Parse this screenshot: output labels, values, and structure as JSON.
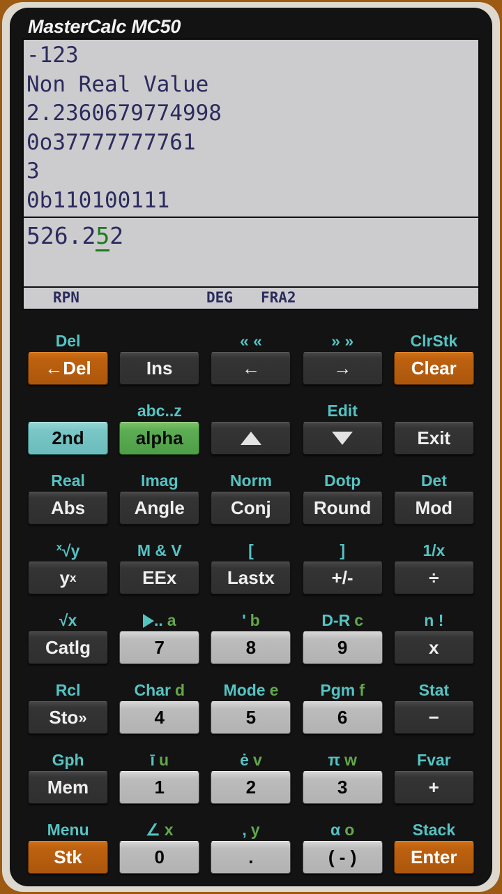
{
  "app": {
    "title": "MasterCalc MC50"
  },
  "display": {
    "stack": [
      "-123",
      "Non Real Value",
      "2.2360679774998",
      "0o37777777761",
      "3",
      "0b110100111"
    ],
    "entry": {
      "before_cursor": "526.2",
      "cursor_char": "5",
      "after_cursor": "2",
      "full_text": "526.252"
    },
    "status": {
      "mode": "RPN",
      "angle": "DEG",
      "format": "FRA2"
    },
    "colors": {
      "screen_bg": "#ccccce",
      "text": "#2b2b5e",
      "cursor": "#1d7a1d"
    }
  },
  "theme": {
    "body": "#131313",
    "bezel": "#ded9cf",
    "edge": "#9d5a13",
    "secondary_label": "#56c3c3",
    "alpha_label": "#63a84a",
    "orange_key": "#bd6110",
    "teal_key": "#7ac6c6",
    "green_key": "#5cad53",
    "light_key": "#bcbcbc",
    "dark_key": "#343434"
  },
  "keypad": {
    "rows": [
      {
        "keys": [
          {
            "sec": "Del",
            "alpha": "",
            "label": "←Del",
            "style": "orange"
          },
          {
            "sec": "",
            "alpha": "",
            "label": "Ins",
            "style": "dark"
          },
          {
            "sec": "« «",
            "alpha": "",
            "label": "←",
            "style": "dark"
          },
          {
            "sec": "» »",
            "alpha": "",
            "label": "→",
            "style": "dark"
          },
          {
            "sec": "ClrStk",
            "alpha": "",
            "label": "Clear",
            "style": "orange"
          }
        ]
      },
      {
        "keys": [
          {
            "sec": "",
            "alpha": "",
            "label": "2nd",
            "style": "teal"
          },
          {
            "sec": "abc..z",
            "alpha": "",
            "label": "alpha",
            "style": "green"
          },
          {
            "sec": "",
            "alpha": "",
            "label": "▲",
            "style": "dark"
          },
          {
            "sec": "Edit",
            "alpha": "",
            "label": "▼",
            "style": "dark"
          },
          {
            "sec": "",
            "alpha": "",
            "label": "Exit",
            "style": "dark"
          }
        ]
      },
      {
        "keys": [
          {
            "sec": "Real",
            "alpha": "",
            "label": "Abs",
            "style": "dark"
          },
          {
            "sec": "Imag",
            "alpha": "",
            "label": "Angle",
            "style": "dark"
          },
          {
            "sec": "Norm",
            "alpha": "",
            "label": "Conj",
            "style": "dark"
          },
          {
            "sec": "Dotp",
            "alpha": "",
            "label": "Round",
            "style": "dark"
          },
          {
            "sec": "Det",
            "alpha": "",
            "label": "Mod",
            "style": "dark"
          }
        ]
      },
      {
        "keys": [
          {
            "sec": "x√y",
            "alpha": "",
            "label": "y^x",
            "style": "dark"
          },
          {
            "sec": "M & V",
            "alpha": "",
            "label": "EEx",
            "style": "dark"
          },
          {
            "sec": "[",
            "alpha": "",
            "label": "Lastx",
            "style": "dark"
          },
          {
            "sec": "]",
            "alpha": "",
            "label": "+/-",
            "style": "dark"
          },
          {
            "sec": "1/x",
            "alpha": "",
            "label": "÷",
            "style": "dark"
          }
        ]
      },
      {
        "keys": [
          {
            "sec": "√x",
            "alpha": "",
            "label": "Catlg",
            "style": "dark"
          },
          {
            "sec": "▶..",
            "alpha": "a",
            "label": "7",
            "style": "light"
          },
          {
            "sec": "'",
            "alpha": "b",
            "label": "8",
            "style": "light"
          },
          {
            "sec": "D-R",
            "alpha": "c",
            "label": "9",
            "style": "light"
          },
          {
            "sec": "n !",
            "alpha": "",
            "label": "x",
            "style": "dark"
          }
        ]
      },
      {
        "keys": [
          {
            "sec": "Rcl",
            "alpha": "",
            "label": "Sto »",
            "style": "dark"
          },
          {
            "sec": "Char",
            "alpha": "d",
            "label": "4",
            "style": "light"
          },
          {
            "sec": "Mode",
            "alpha": "e",
            "label": "5",
            "style": "light"
          },
          {
            "sec": "Pgm",
            "alpha": "f",
            "label": "6",
            "style": "light"
          },
          {
            "sec": "Stat",
            "alpha": "",
            "label": "−",
            "style": "dark"
          }
        ]
      },
      {
        "keys": [
          {
            "sec": "Gph",
            "alpha": "",
            "label": "Mem",
            "style": "dark"
          },
          {
            "sec": "ī",
            "alpha": "u",
            "label": "1",
            "style": "light"
          },
          {
            "sec": "ė",
            "alpha": "v",
            "label": "2",
            "style": "light"
          },
          {
            "sec": "π",
            "alpha": "w",
            "label": "3",
            "style": "light"
          },
          {
            "sec": "Fvar",
            "alpha": "",
            "label": "+",
            "style": "dark"
          }
        ]
      },
      {
        "keys": [
          {
            "sec": "Menu",
            "alpha": "",
            "label": "Stk",
            "style": "orange"
          },
          {
            "sec": "∠",
            "alpha": "x",
            "label": "0",
            "style": "light"
          },
          {
            "sec": ",",
            "alpha": "y",
            "label": ".",
            "style": "light"
          },
          {
            "sec": "α",
            "alpha": "o",
            "label": "( - )",
            "style": "light"
          },
          {
            "sec": "Stack",
            "alpha": "",
            "label": "Enter",
            "style": "orange"
          }
        ]
      }
    ]
  }
}
